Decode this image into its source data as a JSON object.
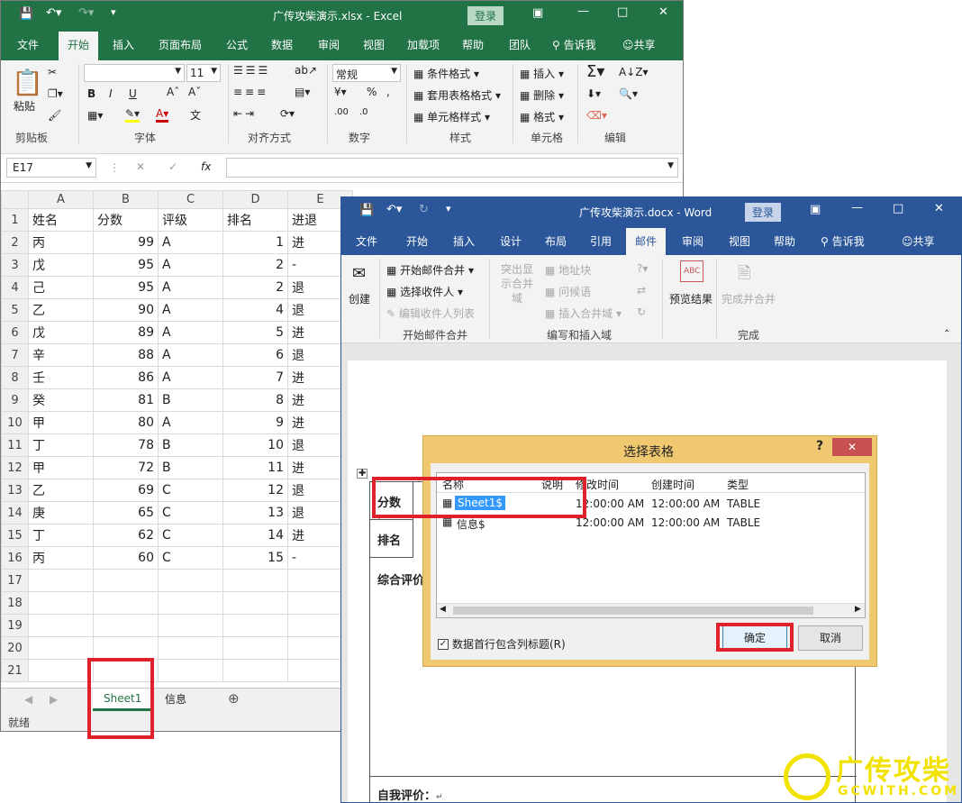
{
  "excel": {
    "title": "广传攻柴演示.xlsx  -  Excel",
    "login": "登录",
    "tabs": [
      "文件",
      "开始",
      "插入",
      "页面布局",
      "公式",
      "数据",
      "审阅",
      "视图",
      "加载项",
      "帮助",
      "团队"
    ],
    "tell_me": "告诉我",
    "share": "共享",
    "ribbon": {
      "paste": "粘贴",
      "clipboard": "剪贴板",
      "font_size": "11",
      "font": "字体",
      "bold": "B",
      "italic": "I",
      "underline": "U",
      "align": "对齐方式",
      "number_format": "常规",
      "number": "数字",
      "cond_format": "条件格式",
      "table_format": "套用表格格式",
      "cell_style": "单元格样式",
      "styles": "样式",
      "insert": "插入",
      "delete": "删除",
      "format": "格式",
      "cells": "单元格",
      "editing": "编辑"
    },
    "name_box": "E17",
    "col_headers": [
      "A",
      "B",
      "C",
      "D",
      "E"
    ],
    "rows": [
      [
        "姓名",
        "分数",
        "评级",
        "排名",
        "进退"
      ],
      [
        "丙",
        "99",
        "A",
        "1",
        "进"
      ],
      [
        "戊",
        "95",
        "A",
        "2",
        "-"
      ],
      [
        "己",
        "95",
        "A",
        "2",
        "退"
      ],
      [
        "乙",
        "90",
        "A",
        "4",
        "退"
      ],
      [
        "戊",
        "89",
        "A",
        "5",
        "进"
      ],
      [
        "辛",
        "88",
        "A",
        "6",
        "退"
      ],
      [
        "壬",
        "86",
        "A",
        "7",
        "进"
      ],
      [
        "癸",
        "81",
        "B",
        "8",
        "进"
      ],
      [
        "甲",
        "80",
        "A",
        "9",
        "进"
      ],
      [
        "丁",
        "78",
        "B",
        "10",
        "退"
      ],
      [
        "甲",
        "72",
        "B",
        "11",
        "进"
      ],
      [
        "乙",
        "69",
        "C",
        "12",
        "退"
      ],
      [
        "庚",
        "65",
        "C",
        "13",
        "退"
      ],
      [
        "丁",
        "62",
        "C",
        "14",
        "进"
      ],
      [
        "丙",
        "60",
        "C",
        "15",
        "-"
      ],
      [
        "",
        "",
        "",
        "",
        ""
      ],
      [
        "",
        "",
        "",
        "",
        ""
      ],
      [
        "",
        "",
        "",
        "",
        ""
      ],
      [
        "",
        "",
        "",
        "",
        ""
      ],
      [
        "",
        "",
        "",
        "",
        ""
      ]
    ],
    "sheets": [
      "Sheet1",
      "信息"
    ],
    "status": "就绪"
  },
  "word": {
    "title": "广传攻柴演示.docx  -  Word",
    "login": "登录",
    "tabs": [
      "文件",
      "开始",
      "插入",
      "设计",
      "布局",
      "引用",
      "邮件",
      "审阅",
      "视图",
      "帮助"
    ],
    "tell_me": "告诉我",
    "share": "共享",
    "ribbon": {
      "create": "创建",
      "start_merge": "开始邮件合并",
      "select_recipients": "选择收件人",
      "edit_recipients": "编辑收件人列表",
      "group_start": "开始邮件合并",
      "highlight": "突出显示合并域",
      "address_block": "地址块",
      "greeting": "问候语",
      "insert_field": "插入合并域",
      "group_write": "编写和插入域",
      "preview": "预览结果",
      "finish": "完成并合并",
      "group_finish": "完成"
    },
    "doc": {
      "score": "分数",
      "rank": "排名",
      "overall": "综合评价",
      "self": "自我评价："
    }
  },
  "dialog": {
    "title": "选择表格",
    "help": "?",
    "columns": [
      "名称",
      "说明",
      "修改时间",
      "创建时间",
      "类型"
    ],
    "rows": [
      {
        "name": "Sheet1$",
        "desc": "",
        "modified": "12:00:00 AM",
        "created": "12:00:00 AM",
        "type": "TABLE"
      },
      {
        "name": "信息$",
        "desc": "",
        "modified": "12:00:00 AM",
        "created": "12:00:00 AM",
        "type": "TABLE"
      }
    ],
    "header_checkbox": "数据首行包含列标题(R)",
    "ok": "确定",
    "cancel": "取消"
  },
  "watermark": {
    "text": "广传攻柴",
    "url": "GCWITH.COM"
  },
  "colors": {
    "excel_green": "#217346",
    "word_blue": "#2b579a",
    "highlight_red": "#e0202a",
    "selection": "#3399ff"
  }
}
